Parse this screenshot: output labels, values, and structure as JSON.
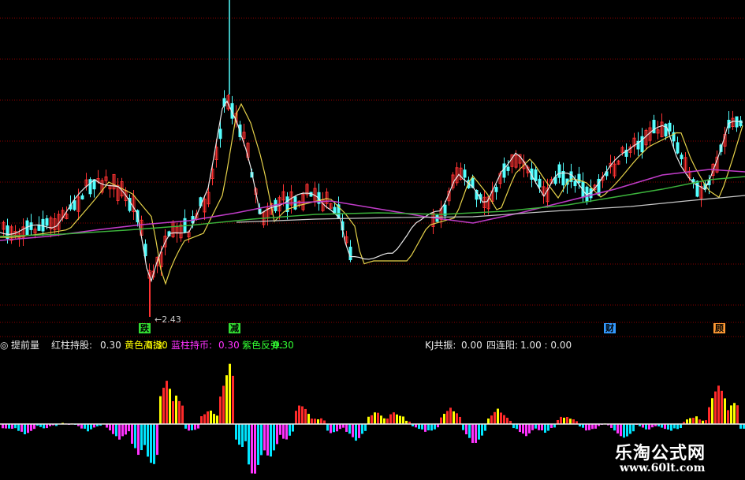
{
  "indicator": {
    "marker": "◎",
    "name": "提前量",
    "red_label": "红柱持股:",
    "red_value": "0.30",
    "yellow_label": "黄色高抛:",
    "yellow_value": "0.30",
    "blue_label": "蓝柱持币:",
    "blue_value": "0.30",
    "purple_label": "紫色反弹:",
    "purple_value": "0.30",
    "kj_label": "KJ共振:",
    "kj_value": "0.00",
    "four_label": "四连阳:",
    "four_value": "1.00 : 0.00"
  },
  "signals": {
    "fall": "跌",
    "reduce": "减",
    "wealth": "财",
    "last": "顾"
  },
  "price_low_label": "←2.43",
  "watermark": {
    "site_name": "乐淘公式网",
    "url": "www.60lt.com"
  },
  "colors": {
    "background": "#000000",
    "grid_red": "#8b0000",
    "candle_up": "#ff3232",
    "candle_down": "#54ffff",
    "ma_white": "#e8e8e8",
    "ma_yellow": "#e6d24a",
    "ma_purple": "#c03cc8",
    "ma_green": "#3cb43c",
    "ma_gray": "#c8c8c8",
    "hist_red": "#ff2a2a",
    "hist_yellow": "#ffff00",
    "hist_cyan": "#00e5ff",
    "hist_magenta": "#ff33ff",
    "label_white": "#e6e6e6",
    "label_yellow": "#ffff00",
    "label_magenta": "#ff33ff",
    "label_green": "#33ff33"
  }
}
